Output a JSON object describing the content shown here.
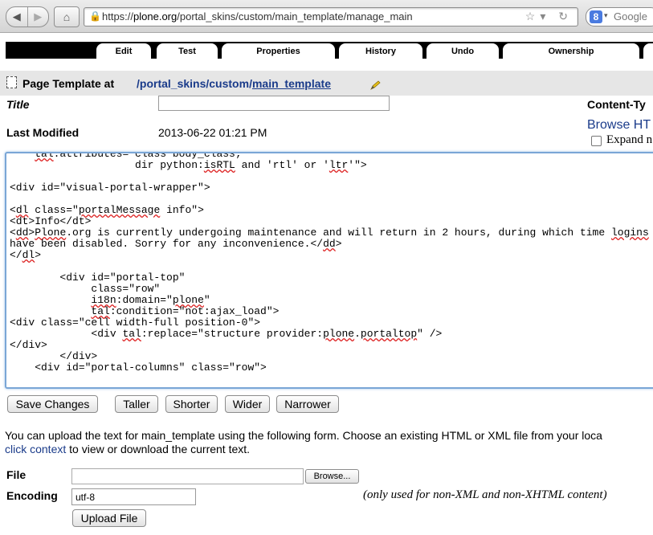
{
  "browser": {
    "back_glyph": "◀",
    "forward_glyph": "▶",
    "home_glyph": "⌂",
    "lock_glyph": "🔒",
    "url_prefix": "https://",
    "url_host": "plone.org",
    "url_path": "/portal_skins/custom/main_template/manage_main",
    "url_right_glyphs": "☆▾ ↻",
    "search_engine_glyph": "8",
    "search_caret": "▾",
    "search_placeholder": "Google",
    "icons": [
      "back-arrow-icon",
      "forward-arrow-icon",
      "home-icon",
      "lock-icon",
      "star-icon",
      "reload-icon",
      "google-icon"
    ]
  },
  "tabs": [
    "Edit",
    "Test",
    "Properties",
    "History",
    "Undo",
    "Ownership"
  ],
  "header": {
    "label": "Page Template at",
    "path": [
      {
        "sep": "/",
        "name": "portal_skins"
      },
      {
        "sep": "/",
        "name": "custom"
      },
      {
        "sep": "/",
        "name": "main_template"
      }
    ]
  },
  "form": {
    "title_label": "Title",
    "title_value": "",
    "content_type_label": "Content-Ty",
    "last_modified_label": "Last Modified",
    "last_modified_value": "2013-06-22 01:21 PM",
    "browse_link": "Browse HT",
    "expand_label": "Expand n"
  },
  "code_lines": [
    "    tal:attributes=\"class body_class;",
    "                    dir python:isRTL and 'rtl' or 'ltr'\">",
    "",
    "<div id=\"visual-portal-wrapper\">",
    "",
    "<dl class=\"portalMessage info\">",
    "<dt>Info</dt>",
    "<dd>Plone.org is currently undergoing maintenance and will return in 2 hours, during which time logins",
    "have been disabled. Sorry for any inconvenience.</dd>",
    "</dl>",
    "",
    "        <div id=\"portal-top\"",
    "             class=\"row\"",
    "             i18n:domain=\"plone\"",
    "             tal:condition=\"not:ajax_load\">",
    "<div class=\"cell width-full position-0\">",
    "             <div tal:replace=\"structure provider:plone.portaltop\" />",
    "</div>",
    "        </div>",
    "    <div id=\"portal-columns\" class=\"row\">"
  ],
  "buttons": {
    "save": "Save Changes",
    "taller": "Taller",
    "shorter": "Shorter",
    "wider": "Wider",
    "narrower": "Narrower"
  },
  "upload": {
    "line1": "You can upload the text for main_template using the following form. Choose an existing HTML or XML file from your loca",
    "link": "click context",
    "line2_rest": " to view or download the current text.",
    "file_label": "File",
    "browse_button": "Browse...",
    "encoding_label": "Encoding",
    "encoding_value": "utf-8",
    "encoding_note": "(only used for non-XML and non-XHTML content)",
    "upload_button": "Upload File"
  }
}
